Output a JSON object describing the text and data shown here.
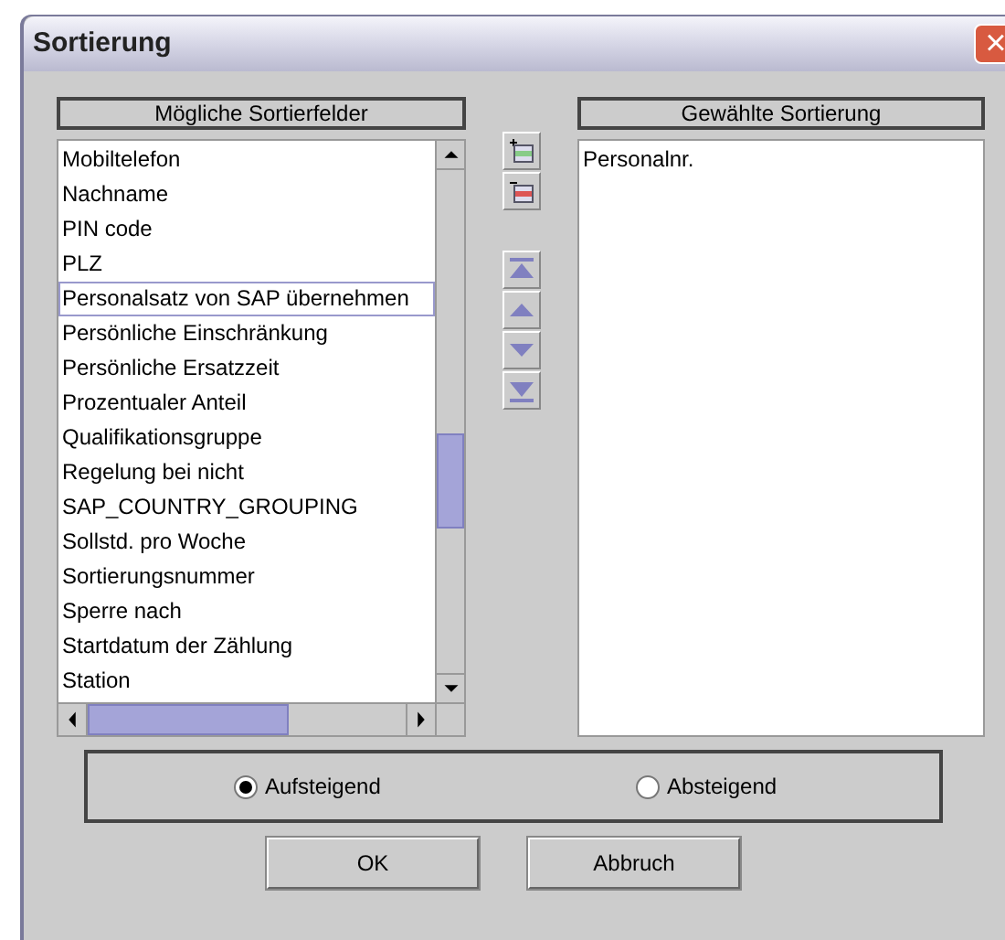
{
  "window": {
    "title": "Sortierung",
    "close": "×"
  },
  "available": {
    "header": "Mögliche Sortierfelder",
    "items": [
      {
        "label": "Mobiltelefon",
        "selected": false
      },
      {
        "label": "Nachname",
        "selected": false
      },
      {
        "label": "PIN code",
        "selected": false
      },
      {
        "label": "PLZ",
        "selected": false
      },
      {
        "label": "Personalsatz von SAP übernehmen",
        "selected": true
      },
      {
        "label": "Persönliche Einschränkung",
        "selected": false
      },
      {
        "label": "Persönliche Ersatzzeit",
        "selected": false
      },
      {
        "label": "Prozentualer Anteil",
        "selected": false
      },
      {
        "label": "Qualifikationsgruppe",
        "selected": false
      },
      {
        "label": "Regelung bei nicht",
        "selected": false
      },
      {
        "label": "SAP_COUNTRY_GROUPING",
        "selected": false
      },
      {
        "label": "Sollstd. pro Woche",
        "selected": false
      },
      {
        "label": "Sortierungsnummer",
        "selected": false
      },
      {
        "label": "Sperre nach",
        "selected": false
      },
      {
        "label": "Startdatum der Zählung",
        "selected": false
      },
      {
        "label": "Station",
        "selected": false
      }
    ]
  },
  "chosen": {
    "header": "Gewählte Sortierung",
    "items": [
      {
        "label": "Personalnr.",
        "selected": false
      }
    ]
  },
  "order": [
    {
      "label": "Aufsteigend",
      "selected": true
    },
    {
      "label": "Absteigend",
      "selected": false
    }
  ],
  "buttons": [
    "OK",
    "Abbruch"
  ]
}
